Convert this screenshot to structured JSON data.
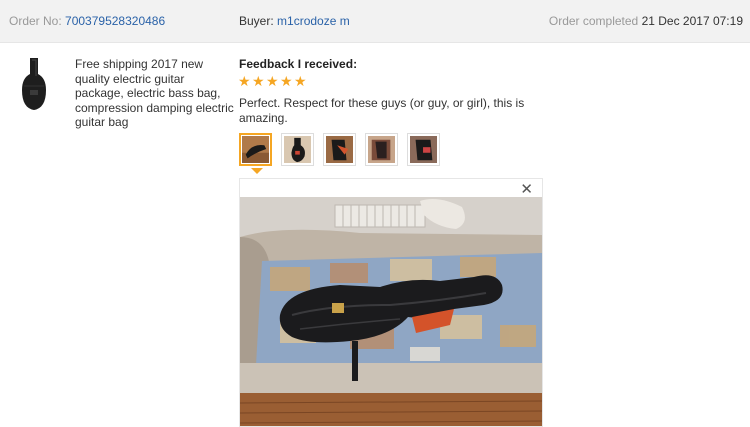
{
  "header": {
    "order_label": "Order No:",
    "order_number": "700379528320486",
    "buyer_label": "Buyer:",
    "buyer_name": "m1crodoze m",
    "status_label": "Order completed",
    "completed_date": "21 Dec 2017 07:19"
  },
  "product": {
    "title": "Free shipping 2017 new quality electric guitar package, electric bass bag, compression damping electric guitar bag",
    "thumbnail_icon": "guitar-bag-icon"
  },
  "feedback": {
    "heading": "Feedback I received:",
    "rating_stars": 5,
    "text": "Perfect. Respect for these guys (or guy, or girl), this is amazing.",
    "photo_count": 5,
    "selected_photo_index": 0
  },
  "viewer": {
    "close_symbol": "✕"
  },
  "colors": {
    "accent": "#f5a623",
    "link": "#2a62a8",
    "header_bg": "#f2f2f2"
  }
}
